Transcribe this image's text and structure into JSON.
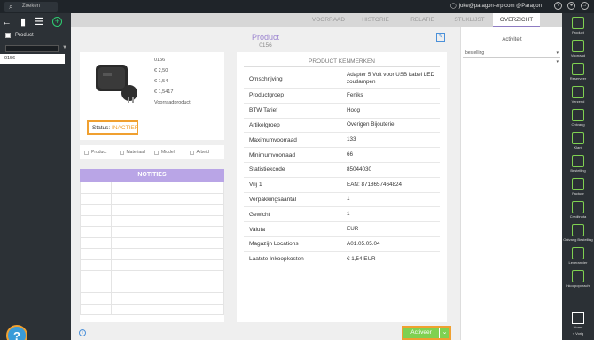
{
  "search": {
    "placeholder": "Zoeken"
  },
  "user": {
    "email": "joke@paragon-erp.com @Paragon"
  },
  "leftpanel": {
    "filter_label": "Product",
    "items": [
      "0156"
    ]
  },
  "tabs": [
    {
      "label": "VOORRAAD"
    },
    {
      "label": "HISTORIE"
    },
    {
      "label": "RELATIE"
    },
    {
      "label": "STUKLIJST"
    },
    {
      "label": "OVERZICHT"
    }
  ],
  "product": {
    "title": "Product",
    "code": "0156",
    "quick": [
      "0156",
      "€ 2,50",
      "€ 1,54",
      "€ 1,5417",
      "Voorraadproduct"
    ],
    "status_label": "Status:",
    "status_value": "INACTIEF"
  },
  "types": [
    {
      "label": "Product"
    },
    {
      "label": "Materiaal"
    },
    {
      "label": "Middel"
    },
    {
      "label": "Arbeid"
    }
  ],
  "notities": {
    "title": "NOTITIES"
  },
  "kenmerken": {
    "title": "PRODUCT KENMERKEN",
    "rows": [
      {
        "key": "Omschrijving",
        "value": "Adapter 5 Volt voor USB kabel LED zoutlampen"
      },
      {
        "key": "Productgroep",
        "value": "Feniks"
      },
      {
        "key": "BTW Tarief",
        "value": "Hoog"
      },
      {
        "key": "Artikelgroep",
        "value": "Overigen Bijouterie"
      },
      {
        "key": "Maximumvoorraad",
        "value": "133"
      },
      {
        "key": "Minimumvoorraad",
        "value": "66"
      },
      {
        "key": "Statistiekcode",
        "value": "85044030"
      },
      {
        "key": "Vrij 1",
        "value": "EAN: 8718657464824"
      },
      {
        "key": "Verpakkingsaantal",
        "value": "1"
      },
      {
        "key": "Gewicht",
        "value": "1"
      },
      {
        "key": "Valuta",
        "value": "EUR"
      },
      {
        "key": "Magazijn Locations",
        "value": "A01.05.05.04"
      },
      {
        "key": "Laatste Inkoopkosten",
        "value": "€ 1,54 EUR"
      }
    ]
  },
  "actions": {
    "activeer": "Activeer"
  },
  "activity": {
    "title": "Activiteit",
    "select1": "bestelling",
    "select2": ""
  },
  "rightnav": [
    {
      "label": "Product"
    },
    {
      "label": "Voorraad"
    },
    {
      "label": "Reserveer"
    },
    {
      "label": "Verzend"
    },
    {
      "label": "Ontvang"
    },
    {
      "label": "Klant"
    },
    {
      "label": "Bestelling"
    },
    {
      "label": "Factuur"
    },
    {
      "label": "Creditnota"
    },
    {
      "label": "Ontvang Bestelling"
    },
    {
      "label": "Leverancier"
    },
    {
      "label": "Inkoopopdracht"
    },
    {
      "label": "Home"
    },
    {
      "label": "< Vorig"
    }
  ]
}
